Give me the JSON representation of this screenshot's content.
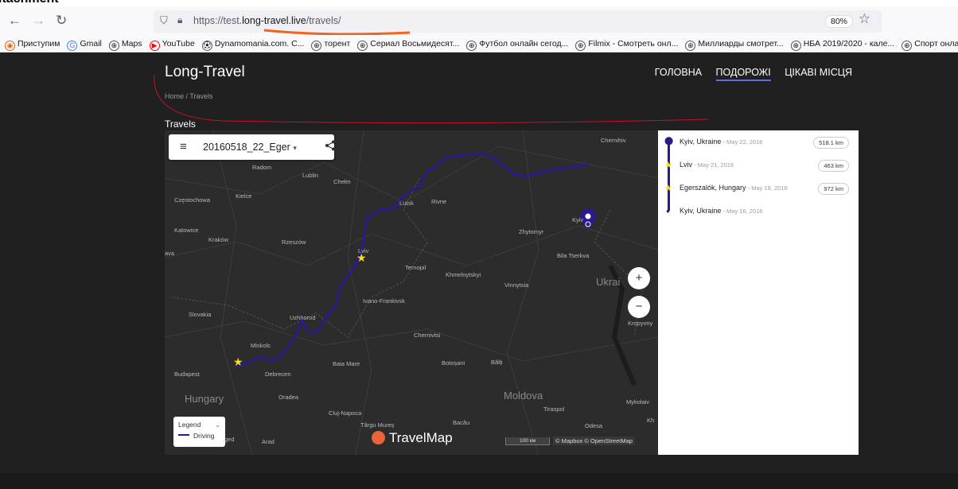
{
  "clipped_title": "itachment",
  "browser": {
    "back": "←",
    "forward": "→",
    "reload": "↻",
    "url_prefix": "https://test.",
    "url_domain": "long-travel.live",
    "url_path": "/travels/",
    "zoom": "80%",
    "bookmark_star": "☆",
    "bookmarks": [
      {
        "label": "Приступим",
        "icon": "firefox-icon"
      },
      {
        "label": "Gmail",
        "icon": "google-icon"
      },
      {
        "label": "Maps",
        "icon": "globe-icon"
      },
      {
        "label": "YouTube",
        "icon": "youtube-icon"
      },
      {
        "label": "Dynamomania.com. C...",
        "icon": "ball-icon"
      },
      {
        "label": "торент",
        "icon": "globe-icon"
      },
      {
        "label": "Сериал Восьмидесят...",
        "icon": "globe-icon"
      },
      {
        "label": "Футбол онлайн сегод...",
        "icon": "globe-icon"
      },
      {
        "label": "Filmix - Смотреть онл...",
        "icon": "globe-icon"
      },
      {
        "label": "Миллиарды смотрет...",
        "icon": "globe-icon"
      },
      {
        "label": "НБА 2019/2020 - кале...",
        "icon": "globe-icon"
      },
      {
        "label": "Спорт онлайн",
        "icon": "globe-icon"
      }
    ]
  },
  "site": {
    "logo": "Long-Travel",
    "nav": [
      "ГОЛОВНА",
      "ПОДОРОЖІ",
      "ЦІКАВІ МІСЦЯ"
    ],
    "active_nav": "ПОДОРОЖІ",
    "breadcrumb": "Home / Travels",
    "section_title": "Travels"
  },
  "map": {
    "trip_name": "20160518_22_Eger",
    "trip_dropdown": "▾",
    "menu_icon": "≡",
    "share_icon": "share-icon",
    "zoom_in": "+",
    "zoom_out": "−",
    "legend_title": "Legend",
    "legend_chevron": "⌄",
    "legend_item": "Driving",
    "brand": "TravelMap",
    "scale": "100 км",
    "attribution": "© Mapbox © OpenStreetMap",
    "route_color": "#2b1a8a",
    "labels": [
      "Chernihiv",
      "Radom",
      "Lublin",
      "Chełm",
      "Lutsk",
      "Rivne",
      "Częstochowa",
      "Kielce",
      "Katowice",
      "Kraków",
      "Rzeszów",
      "Lviv",
      "Kyiv",
      "Zhytomyr",
      "Bila Tserkva",
      "Ternopil",
      "Khmelnytskyi",
      "Vinnytsia",
      "Ukrai",
      "Ivano-Frankivsk",
      "Slovakia",
      "Uzhhorod",
      "Kropyvny",
      "Chernivtsi",
      "Miskolc",
      "Budapest",
      "Debrecen",
      "Baia Mare",
      "Botoșani",
      "Bălți",
      "Hungary",
      "Oradea",
      "Moldova",
      "Mykolaiv",
      "Tiraspol",
      "Kh",
      "Cluj-Napoca",
      "Târgu Mureș",
      "Bacău",
      "Odesa",
      "Arad",
      "ava",
      "ged"
    ]
  },
  "itinerary": {
    "stops": [
      {
        "place": "Kyiv, Ukraine",
        "date": "May 22, 2016",
        "distance": "518.1 km"
      },
      {
        "place": "Lviv",
        "date": "May 21, 2016",
        "distance": "463 km"
      },
      {
        "place": "Egerszalók, Hungary",
        "date": "May 18, 2016",
        "distance": "972 km"
      },
      {
        "place": "Kyiv, Ukraine",
        "date": "May 16, 2016",
        "distance": ""
      }
    ]
  }
}
